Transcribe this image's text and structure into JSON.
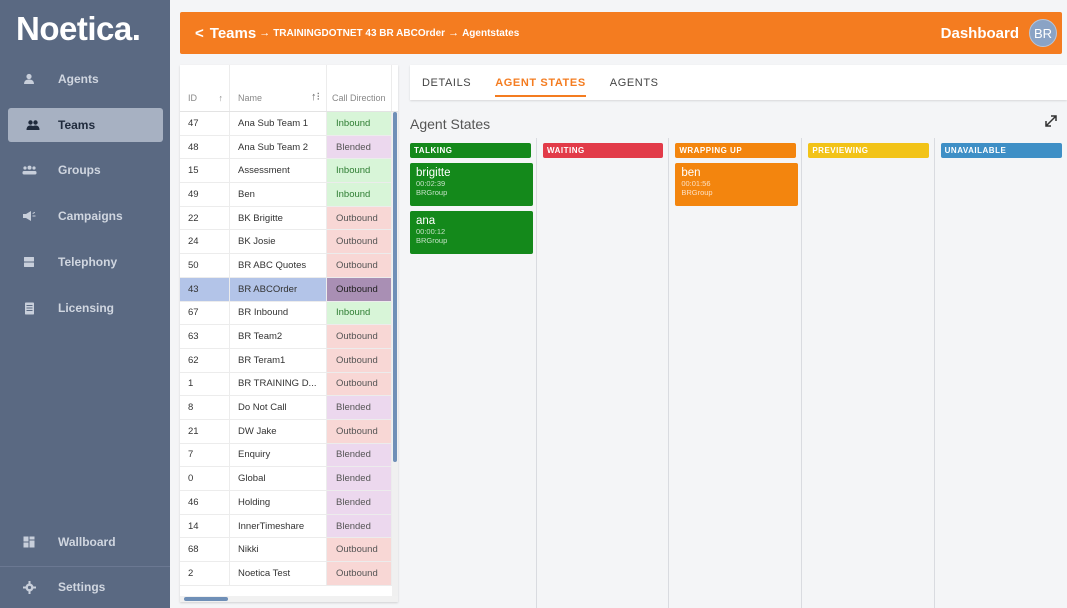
{
  "app": {
    "logo": "Noetica."
  },
  "sidebar": {
    "items": [
      {
        "label": "Agents",
        "icon": "person-icon"
      },
      {
        "label": "Teams",
        "icon": "people-icon",
        "active": true
      },
      {
        "label": "Groups",
        "icon": "groups-icon"
      },
      {
        "label": "Campaigns",
        "icon": "megaphone-icon"
      },
      {
        "label": "Telephony",
        "icon": "server-icon"
      },
      {
        "label": "Licensing",
        "icon": "document-icon"
      }
    ],
    "bottom": [
      {
        "label": "Wallboard",
        "icon": "dashboard-icon"
      },
      {
        "label": "Settings",
        "icon": "gear-icon"
      }
    ]
  },
  "header": {
    "back": "<",
    "root": "Teams",
    "sep1": "→",
    "team": "TRAININGDOTNET 43 BR ABCOrder",
    "sep2": "→",
    "page": "Agentstates",
    "dashboard": "Dashboard",
    "avatar": "BR"
  },
  "table": {
    "headers": {
      "id": "ID",
      "name": "Name",
      "direction": "Call Direction"
    },
    "rows": [
      {
        "id": "47",
        "name": "Ana Sub Team 1",
        "dir": "Inbound"
      },
      {
        "id": "48",
        "name": "Ana Sub Team 2",
        "dir": "Blended"
      },
      {
        "id": "15",
        "name": "Assessment",
        "dir": "Inbound"
      },
      {
        "id": "49",
        "name": "Ben",
        "dir": "Inbound"
      },
      {
        "id": "22",
        "name": "BK Brigitte",
        "dir": "Outbound"
      },
      {
        "id": "24",
        "name": "BK Josie",
        "dir": "Outbound"
      },
      {
        "id": "50",
        "name": "BR ABC Quotes",
        "dir": "Outbound"
      },
      {
        "id": "43",
        "name": "BR ABCOrder",
        "dir": "Outbound",
        "selected": true
      },
      {
        "id": "67",
        "name": "BR Inbound",
        "dir": "Inbound"
      },
      {
        "id": "63",
        "name": "BR Team2",
        "dir": "Outbound"
      },
      {
        "id": "62",
        "name": "BR Teram1",
        "dir": "Outbound"
      },
      {
        "id": "1",
        "name": "BR TRAINING D...",
        "dir": "Outbound"
      },
      {
        "id": "8",
        "name": "Do Not Call",
        "dir": "Blended"
      },
      {
        "id": "21",
        "name": "DW Jake",
        "dir": "Outbound"
      },
      {
        "id": "7",
        "name": "Enquiry",
        "dir": "Blended"
      },
      {
        "id": "0",
        "name": "Global",
        "dir": "Blended"
      },
      {
        "id": "46",
        "name": "Holding",
        "dir": "Blended"
      },
      {
        "id": "14",
        "name": "InnerTimeshare",
        "dir": "Blended"
      },
      {
        "id": "68",
        "name": "Nikki",
        "dir": "Outbound"
      },
      {
        "id": "2",
        "name": "Noetica Test",
        "dir": "Outbound"
      }
    ]
  },
  "tabs": [
    {
      "label": "DETAILS"
    },
    {
      "label": "AGENT STATES",
      "active": true
    },
    {
      "label": "AGENTS"
    }
  ],
  "agent_states": {
    "title": "Agent States",
    "columns": [
      {
        "label": "TALKING",
        "color": "#14891b",
        "cards": [
          {
            "name": "brigitte",
            "time": "00:02:39",
            "group": "BRGroup"
          },
          {
            "name": "ana",
            "time": "00:00:12",
            "group": "BRGroup"
          }
        ]
      },
      {
        "label": "WAITING",
        "color": "#e23b49",
        "cards": []
      },
      {
        "label": "WRAPPING UP",
        "color": "#f3850e",
        "cards": [
          {
            "name": "ben",
            "time": "00:01:56",
            "group": "BRGroup"
          }
        ]
      },
      {
        "label": "PREVIEWING",
        "color": "#f2c318",
        "cards": []
      },
      {
        "label": "UNAVAILABLE",
        "color": "#3e8fc6",
        "cards": []
      }
    ]
  },
  "colors": {
    "accent": "#f47c20",
    "sidebar": "#5a6982"
  }
}
